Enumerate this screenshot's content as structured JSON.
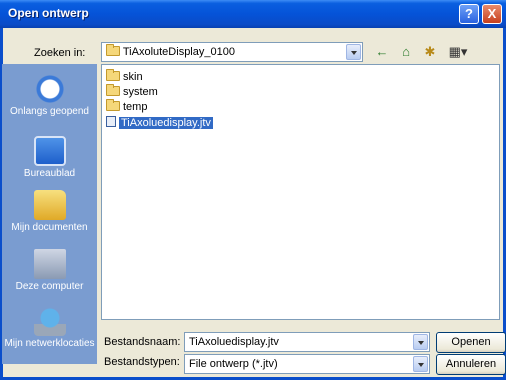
{
  "window": {
    "title": "Open ontwerp"
  },
  "titlebar": {
    "help": "?",
    "close": "X"
  },
  "lookin": {
    "label": "Zoeken in:",
    "value": "TiAxoluteDisplay_0100"
  },
  "toolbar": {
    "back": "←",
    "up": "⌂",
    "newfolder": "✱",
    "views": "▦▾"
  },
  "places": {
    "recent": "Onlangs geopend",
    "desktop": "Bureaublad",
    "documents": "Mijn documenten",
    "computer": "Deze computer",
    "network": "Mijn netwerklocaties"
  },
  "files": [
    {
      "name": "skin",
      "type": "folder"
    },
    {
      "name": "system",
      "type": "folder"
    },
    {
      "name": "temp",
      "type": "folder"
    },
    {
      "name": "TiAxoluedisplay.jtv",
      "type": "file"
    }
  ],
  "filename": {
    "label": "Bestandsnaam:",
    "value": "TiAxoluedisplay.jtv"
  },
  "filetype": {
    "label": "Bestandstypen:",
    "value": "File ontwerp (*.jtv)"
  },
  "buttons": {
    "open": "Openen",
    "cancel": "Annuleren"
  }
}
